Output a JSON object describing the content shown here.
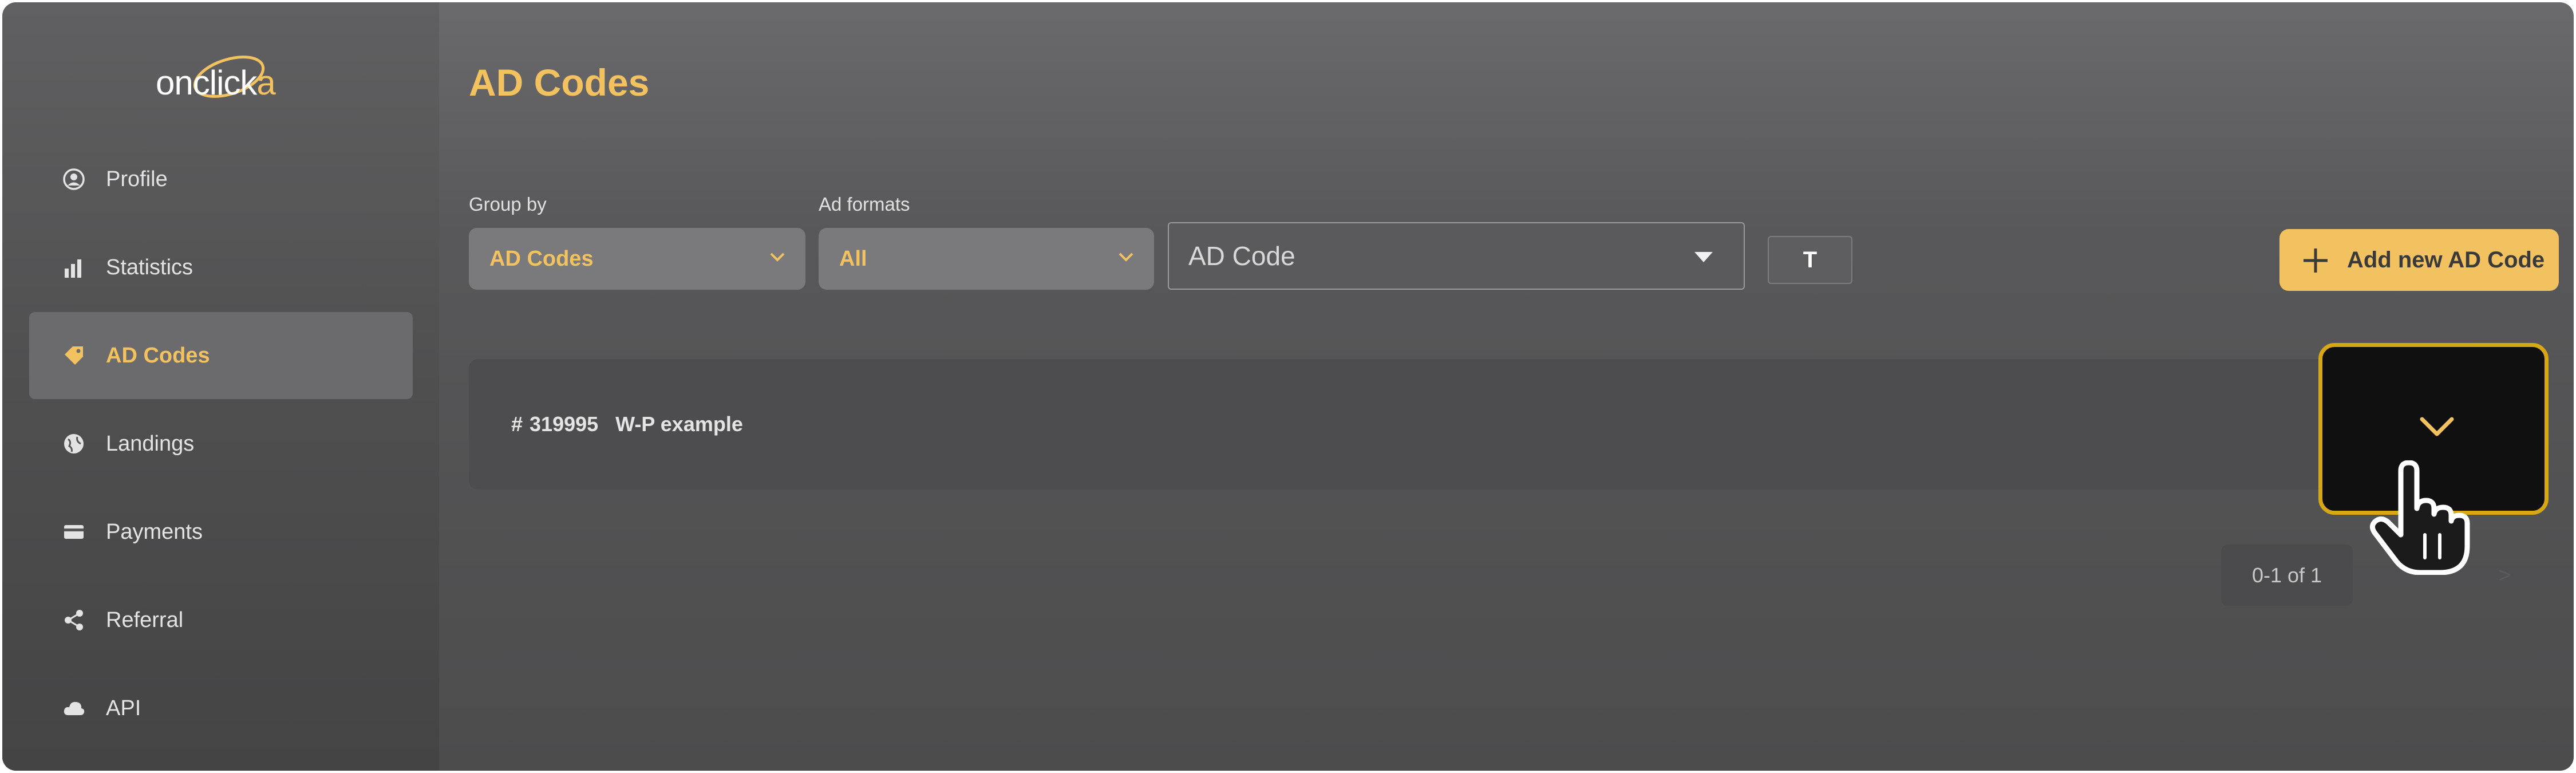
{
  "app": {
    "logo_text_main": "onclick",
    "logo_text_accent": "a"
  },
  "sidebar": {
    "items": [
      {
        "label": "Profile",
        "icon": "profile-icon",
        "active": false
      },
      {
        "label": "Statistics",
        "icon": "statistics-icon",
        "active": false
      },
      {
        "label": "AD Codes",
        "icon": "tag-icon",
        "active": true
      },
      {
        "label": "Landings",
        "icon": "globe-icon",
        "active": false
      },
      {
        "label": "Payments",
        "icon": "card-icon",
        "active": false
      },
      {
        "label": "Referral",
        "icon": "share-icon",
        "active": false
      },
      {
        "label": "API",
        "icon": "cloud-icon",
        "active": false
      }
    ]
  },
  "main": {
    "title": "AD Codes",
    "filters": {
      "group_by_label": "Group by",
      "group_by_value": "AD Codes",
      "ad_formats_label": "Ad formats",
      "ad_formats_value": "All",
      "ad_code_placeholder": "AD Code",
      "t_button_label": "T"
    },
    "add_button_label": "Add new AD Code",
    "rows": [
      {
        "hash": "#",
        "id": "319995",
        "name": "W-P example"
      }
    ],
    "pagination": {
      "range": "0-1 of 1",
      "next_symbol": ">"
    }
  },
  "colors": {
    "accent": "#f2c260",
    "highlight_border": "#d7a716",
    "background": "#58585a"
  }
}
